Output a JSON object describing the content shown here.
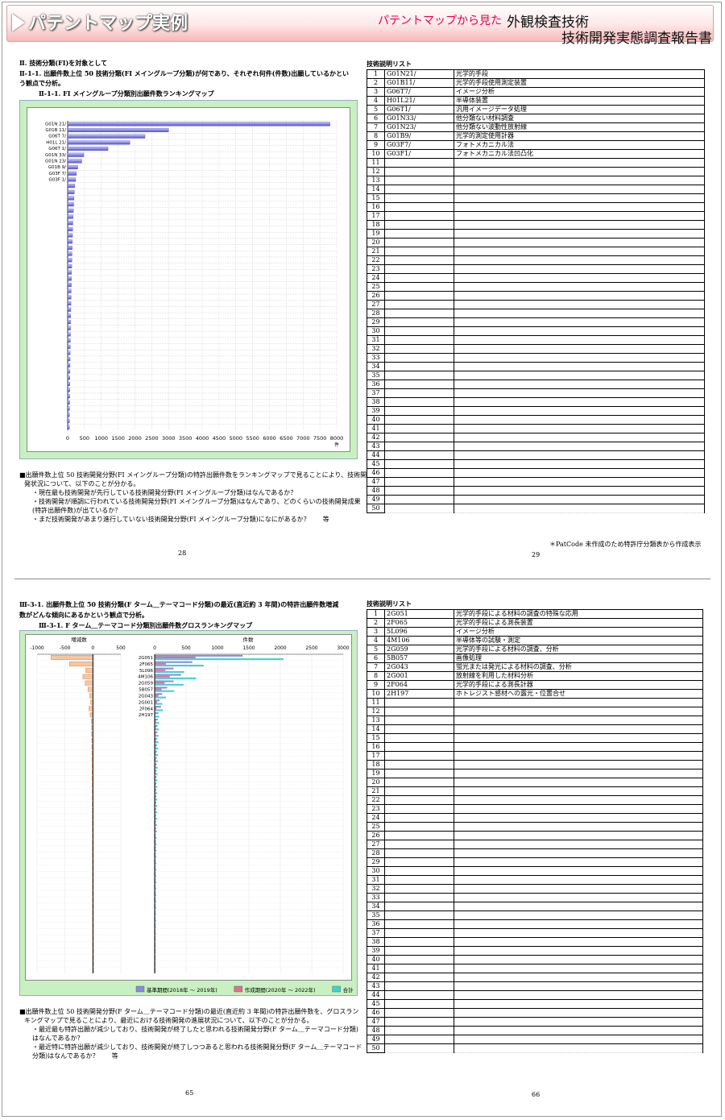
{
  "header": {
    "title": "パテントマップ実例",
    "subtitle_red": "パテントマップから見た",
    "subtitle_main": "外観検査技術",
    "subtitle_report": "技術開発実態調査報告書"
  },
  "page1": {
    "section": "Ⅱ. 技術分類(FI)を対象として",
    "heading_line1": "Ⅱ-1-1. 出願件数上位 50 技術分類(FI メイングループ分類)が何であり、それぞれ何件(件数)出願しているかとい",
    "heading_line2": "う観点で分析。",
    "chart_title": "Ⅱ-1-1. FI メイングループ分類別出願件数ランキングマップ",
    "notes": [
      "■出願件数上位 50 技術開発分野(FI メイングループ分類)の特許出願件数をランキングマップで見ることにより、技術開",
      "発状況について、以下のことが分かる。",
      "・現在最も技術開発が先行している技術開発分野(FI メイングループ分類)はなんであるか？",
      "・技術開発が順調に行われている技術開発分野(FI メイングループ分類)はなんであり、どのくらいの技術開発成果",
      "(特許出願件数)が出ているか？",
      "・まだ技術開発があまり進行していない技術開発分野(FI メイングループ分類)になにがあるか？　　等"
    ],
    "page_left": "28",
    "page_right": "29",
    "table_title": "技術説明リスト",
    "footnote": "＊PatCode 未作成のため特許庁分類表から作成表示"
  },
  "page2": {
    "heading_line1": "Ⅲ-3-1. 出願件数上位 50 技術分類(F ターム＿テーマコード分類)の最近(直近約 3 年間)の特許出願件数増減",
    "heading_line2": "数がどんな傾向にあるかという観点で分析。",
    "chart_title": "Ⅲ-3-1. F ターム＿テーマコード分類別出願件数グロスランキングマップ",
    "notes": [
      "■出願件数上位 50 技術開発分野(F ターム＿テーマコード分類)の最近(直近約 3 年間)の特許出願件数を、グロスラン",
      "キングマップで見ることにより、最近における技術開発の進展状況について、以下のことが分かる。",
      "・最近最も特許出願が減少しており、技術開発が終了したと思われる技術開発分野(F ターム＿テーマコード分類)",
      "はなんであるか？",
      "・最近特に特許出願が減少しており、技術開発が終了しつつあると思われる技術開発分野(F ターム＿テーマコード",
      "分類)はなんであるか？　　等"
    ],
    "page_left": "65",
    "page_right": "66",
    "table_title": "技術説明リスト"
  },
  "chart_data": [
    {
      "type": "bar",
      "orientation": "horizontal",
      "title": "Ⅱ-1-1. FI メイングループ分類別出願件数ランキングマップ",
      "categories": [
        "G01N 21/",
        "G01B 11/",
        "G06T 7/",
        "H01L 21/",
        "G06T 1/",
        "G01N 33/",
        "G01N 23/",
        "G01B 9/",
        "G03F 7/",
        "G03F 1/"
      ],
      "values": [
        7800,
        3000,
        2300,
        1850,
        1200,
        480,
        420,
        300,
        260,
        240,
        210,
        200,
        190,
        180,
        170,
        160,
        155,
        150,
        145,
        140,
        135,
        130,
        126,
        122,
        118,
        114,
        110,
        106,
        102,
        98,
        95,
        92,
        89,
        86,
        83,
        80,
        78,
        76,
        74,
        72,
        70,
        68,
        66,
        64,
        62,
        60,
        58,
        56,
        54,
        52
      ],
      "xlim": [
        0,
        8000
      ],
      "xticks": [
        0,
        500,
        1000,
        1500,
        2000,
        2500,
        3000,
        3500,
        4000,
        4500,
        5000,
        5500,
        6000,
        6500,
        7000,
        7500,
        8000
      ],
      "xunit": "件",
      "grid": true
    },
    {
      "type": "bar",
      "orientation": "horizontal",
      "title": "Ⅲ-3-1. F ターム＿テーマコード分類別出願件数グロスランキングマップ",
      "categories": [
        "2G051",
        "2F065",
        "5L096",
        "4M106",
        "2G059",
        "5B057",
        "2G043",
        "2G001",
        "2F064",
        "2H197"
      ],
      "left_panel": {
        "label": "増減数",
        "xlim": [
          -1000,
          500
        ],
        "xticks": [
          -1000,
          -500,
          0,
          500
        ],
        "values": [
          -750,
          -420,
          -130,
          -180,
          -140,
          -90,
          -60,
          -40,
          -70,
          -50,
          -30,
          -25,
          -25,
          -20,
          -20,
          -18,
          -18,
          -16,
          -15,
          -15,
          -14,
          -13,
          -12,
          -12,
          -11,
          -10,
          -10,
          -9,
          -9,
          -8,
          -8,
          -8,
          -7,
          -7,
          -7,
          -6,
          -6,
          -6,
          -5,
          -5,
          -5,
          -5,
          -4,
          -4,
          -4,
          -4,
          -3,
          -3,
          -3,
          -3
        ]
      },
      "right_panel": {
        "label": "件数",
        "xlim": [
          0,
          3000
        ],
        "xticks": [
          0,
          500,
          1000,
          1500,
          2000,
          2500,
          3000
        ],
        "series": [
          {
            "name": "基準期間(2018年 ～ 2019年)",
            "color": "#8a8ae0",
            "values": [
              1400,
              600,
              300,
              420,
              300,
              200,
              120,
              80,
              100,
              60,
              50,
              45,
              42,
              40,
              38,
              36,
              34,
              32,
              30,
              29,
              28,
              27,
              26,
              25,
              24,
              23,
              22,
              21,
              20,
              19,
              18,
              18,
              17,
              17,
              16,
              16,
              15,
              15,
              14,
              14,
              13,
              13,
              12,
              12,
              11,
              11,
              10,
              10,
              10,
              9
            ]
          },
          {
            "name": "作成期間(2020年 ～ 2022年)",
            "color": "#e07090",
            "values": [
              650,
              180,
              170,
              240,
              160,
              110,
              60,
              40,
              30,
              10,
              20,
              20,
              17,
              20,
              18,
              18,
              16,
              16,
              15,
              14,
              14,
              14,
              14,
              13,
              13,
              13,
              12,
              12,
              11,
              11,
              10,
              10,
              10,
              10,
              9,
              10,
              9,
              9,
              9,
              9,
              8,
              8,
              8,
              8,
              7,
              7,
              7,
              7,
              7,
              6
            ]
          },
          {
            "name": "合計",
            "color": "#40d0d0",
            "values": [
              2050,
              780,
              470,
              660,
              460,
              310,
              180,
              120,
              130,
              70,
              70,
              65,
              59,
              60,
              56,
              54,
              50,
              48,
              45,
              43,
              42,
              41,
              40,
              38,
              37,
              36,
              34,
              33,
              31,
              30,
              28,
              28,
              27,
              27,
              25,
              26,
              24,
              24,
              23,
              23,
              21,
              21,
              20,
              20,
              18,
              18,
              17,
              17,
              17,
              15
            ]
          }
        ]
      }
    }
  ],
  "table1_rows": [
    {
      "no": "1",
      "code": "G01N21/",
      "desc": "光学的手段"
    },
    {
      "no": "2",
      "code": "G01B11/",
      "desc": "光学的手段使用測定装置"
    },
    {
      "no": "3",
      "code": "G06T7/",
      "desc": "イメージ分析"
    },
    {
      "no": "4",
      "code": "H01L21/",
      "desc": "半導体装置"
    },
    {
      "no": "5",
      "code": "G06T1/",
      "desc": "汎用イメージデータ処理"
    },
    {
      "no": "6",
      "code": "G01N33/",
      "desc": "他分類ない材料調査"
    },
    {
      "no": "7",
      "code": "G01N23/",
      "desc": "他分類ない波動性放射線"
    },
    {
      "no": "8",
      "code": "G01B9/",
      "desc": "光学的測定使用計器"
    },
    {
      "no": "9",
      "code": "G03F7/",
      "desc": "フォトメカニカル法"
    },
    {
      "no": "10",
      "code": "G03F1/",
      "desc": "フォトメカニカル法凹凸化"
    },
    {
      "no": "11",
      "code": "",
      "desc": ""
    },
    {
      "no": "12",
      "code": "",
      "desc": ""
    },
    {
      "no": "13",
      "code": "",
      "desc": ""
    },
    {
      "no": "14",
      "code": "",
      "desc": ""
    },
    {
      "no": "15",
      "code": "",
      "desc": ""
    },
    {
      "no": "16",
      "code": "",
      "desc": ""
    },
    {
      "no": "17",
      "code": "",
      "desc": ""
    },
    {
      "no": "18",
      "code": "",
      "desc": ""
    },
    {
      "no": "19",
      "code": "",
      "desc": ""
    },
    {
      "no": "20",
      "code": "",
      "desc": ""
    },
    {
      "no": "21",
      "code": "",
      "desc": ""
    },
    {
      "no": "22",
      "code": "",
      "desc": ""
    },
    {
      "no": "23",
      "code": "",
      "desc": ""
    },
    {
      "no": "24",
      "code": "",
      "desc": ""
    },
    {
      "no": "25",
      "code": "",
      "desc": ""
    },
    {
      "no": "26",
      "code": "",
      "desc": ""
    },
    {
      "no": "27",
      "code": "",
      "desc": ""
    },
    {
      "no": "28",
      "code": "",
      "desc": ""
    },
    {
      "no": "29",
      "code": "",
      "desc": ""
    },
    {
      "no": "30",
      "code": "",
      "desc": ""
    },
    {
      "no": "31",
      "code": "",
      "desc": ""
    },
    {
      "no": "32",
      "code": "",
      "desc": ""
    },
    {
      "no": "33",
      "code": "",
      "desc": ""
    },
    {
      "no": "34",
      "code": "",
      "desc": ""
    },
    {
      "no": "35",
      "code": "",
      "desc": ""
    },
    {
      "no": "36",
      "code": "",
      "desc": ""
    },
    {
      "no": "37",
      "code": "",
      "desc": ""
    },
    {
      "no": "38",
      "code": "",
      "desc": ""
    },
    {
      "no": "39",
      "code": "",
      "desc": ""
    },
    {
      "no": "40",
      "code": "",
      "desc": ""
    },
    {
      "no": "41",
      "code": "",
      "desc": ""
    },
    {
      "no": "42",
      "code": "",
      "desc": ""
    },
    {
      "no": "43",
      "code": "",
      "desc": ""
    },
    {
      "no": "44",
      "code": "",
      "desc": ""
    },
    {
      "no": "45",
      "code": "",
      "desc": ""
    },
    {
      "no": "46",
      "code": "",
      "desc": ""
    },
    {
      "no": "47",
      "code": "",
      "desc": ""
    },
    {
      "no": "48",
      "code": "",
      "desc": ""
    },
    {
      "no": "49",
      "code": "",
      "desc": ""
    },
    {
      "no": "50",
      "code": "",
      "desc": ""
    }
  ],
  "table2_rows": [
    {
      "no": "1",
      "code": "2G051",
      "desc": "光学的手段による材料の調査の特殊な応用"
    },
    {
      "no": "2",
      "code": "2F065",
      "desc": "光学的手段による測長装置"
    },
    {
      "no": "3",
      "code": "5L096",
      "desc": "イメージ分析"
    },
    {
      "no": "4",
      "code": "4M106",
      "desc": "半導体等の試験・測定"
    },
    {
      "no": "5",
      "code": "2G059",
      "desc": "光学的手段による材料の調査、分析"
    },
    {
      "no": "6",
      "code": "5B057",
      "desc": "画像処理"
    },
    {
      "no": "7",
      "code": "2G043",
      "desc": "蛍光または発光による材料の調査、分析"
    },
    {
      "no": "8",
      "code": "2G001",
      "desc": "放射線を利用した材料分析"
    },
    {
      "no": "9",
      "code": "2F064",
      "desc": "光学的手段による測長計器"
    },
    {
      "no": "10",
      "code": "2H197",
      "desc": "ホトレジスト感材への露光・位置合せ"
    },
    {
      "no": "11",
      "code": "",
      "desc": ""
    },
    {
      "no": "12",
      "code": "",
      "desc": ""
    },
    {
      "no": "13",
      "code": "",
      "desc": ""
    },
    {
      "no": "14",
      "code": "",
      "desc": ""
    },
    {
      "no": "15",
      "code": "",
      "desc": ""
    },
    {
      "no": "16",
      "code": "",
      "desc": ""
    },
    {
      "no": "17",
      "code": "",
      "desc": ""
    },
    {
      "no": "18",
      "code": "",
      "desc": ""
    },
    {
      "no": "19",
      "code": "",
      "desc": ""
    },
    {
      "no": "20",
      "code": "",
      "desc": ""
    },
    {
      "no": "21",
      "code": "",
      "desc": ""
    },
    {
      "no": "22",
      "code": "",
      "desc": ""
    },
    {
      "no": "23",
      "code": "",
      "desc": ""
    },
    {
      "no": "24",
      "code": "",
      "desc": ""
    },
    {
      "no": "25",
      "code": "",
      "desc": ""
    },
    {
      "no": "26",
      "code": "",
      "desc": ""
    },
    {
      "no": "27",
      "code": "",
      "desc": ""
    },
    {
      "no": "28",
      "code": "",
      "desc": ""
    },
    {
      "no": "29",
      "code": "",
      "desc": ""
    },
    {
      "no": "30",
      "code": "",
      "desc": ""
    },
    {
      "no": "31",
      "code": "",
      "desc": ""
    },
    {
      "no": "32",
      "code": "",
      "desc": ""
    },
    {
      "no": "33",
      "code": "",
      "desc": ""
    },
    {
      "no": "34",
      "code": "",
      "desc": ""
    },
    {
      "no": "35",
      "code": "",
      "desc": ""
    },
    {
      "no": "36",
      "code": "",
      "desc": ""
    },
    {
      "no": "37",
      "code": "",
      "desc": ""
    },
    {
      "no": "38",
      "code": "",
      "desc": ""
    },
    {
      "no": "39",
      "code": "",
      "desc": ""
    },
    {
      "no": "40",
      "code": "",
      "desc": ""
    },
    {
      "no": "41",
      "code": "",
      "desc": ""
    },
    {
      "no": "42",
      "code": "",
      "desc": ""
    },
    {
      "no": "43",
      "code": "",
      "desc": ""
    },
    {
      "no": "44",
      "code": "",
      "desc": ""
    },
    {
      "no": "45",
      "code": "",
      "desc": ""
    },
    {
      "no": "46",
      "code": "",
      "desc": ""
    },
    {
      "no": "47",
      "code": "",
      "desc": ""
    },
    {
      "no": "48",
      "code": "",
      "desc": ""
    },
    {
      "no": "49",
      "code": "",
      "desc": ""
    },
    {
      "no": "50",
      "code": "",
      "desc": ""
    }
  ]
}
